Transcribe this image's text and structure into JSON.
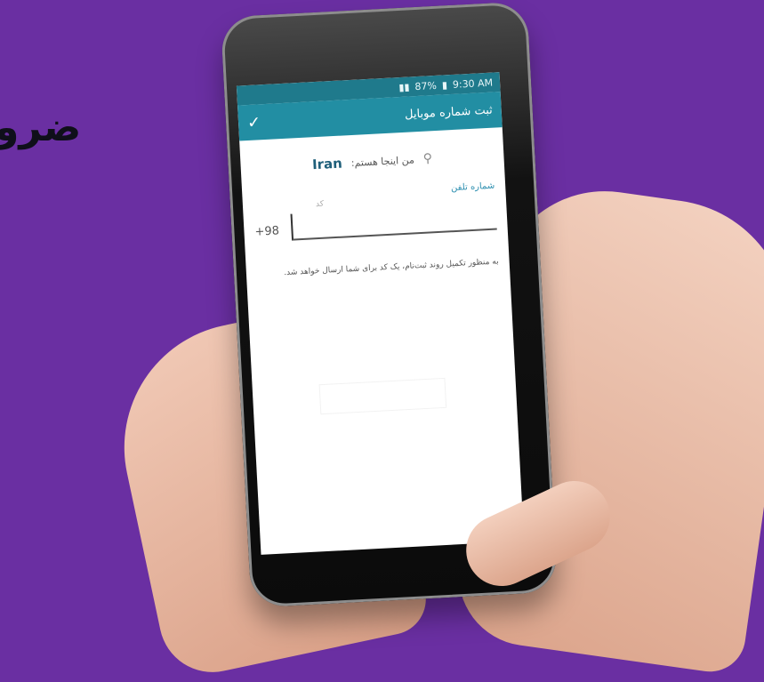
{
  "background": {
    "text": "ضرو",
    "color": "#6a2fa2"
  },
  "status": {
    "battery": "87%",
    "time": "9:30 AM"
  },
  "appbar": {
    "title": "ثبت شماره موبایل",
    "confirm_icon": "check-icon"
  },
  "form": {
    "location_prefix": "من اینجا هستم:",
    "country": "Iran",
    "phone_label": "شماره تلفن",
    "code_label": "کد",
    "code_value": "+98",
    "phone_value": "",
    "info_text": "به منظور تکمیل روند ثبت‌نام، یک کد برای شما ارسال خواهد شد."
  },
  "colors": {
    "statusbar": "#1f7a8c",
    "appbar": "#228ea3",
    "accent": "#2d8fb0"
  }
}
